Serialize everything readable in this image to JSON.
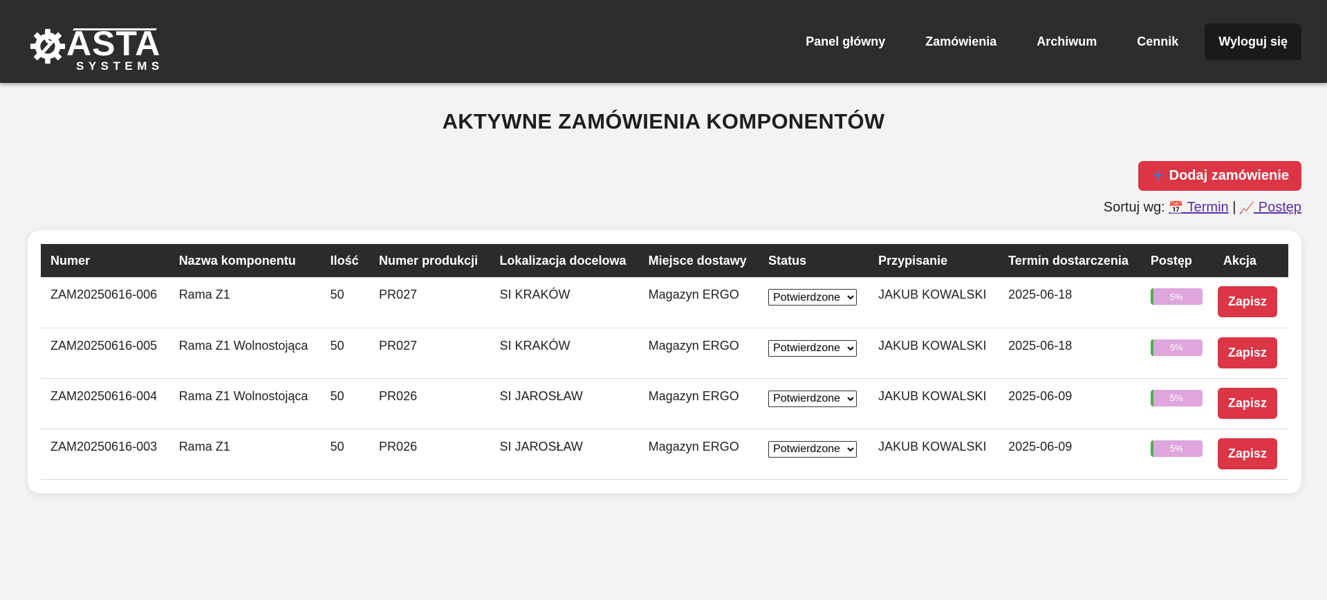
{
  "brand": {
    "logo_main": "ASTA",
    "logo_sub": "SYSTEMS"
  },
  "nav": {
    "items": [
      {
        "label": "Panel główny"
      },
      {
        "label": "Zamówienia"
      },
      {
        "label": "Archiwum"
      },
      {
        "label": "Cennik"
      }
    ],
    "logout_label": "Wyloguj się"
  },
  "page": {
    "title": "AKTYWNE ZAMÓWIENIA KOMPONENTÓW",
    "add_button_label": "Dodaj zamówienie",
    "add_button_icon": "plus-icon",
    "sort_label": "Sortuj wg:",
    "sort_separator": "|",
    "sort_options": [
      {
        "label": " Termin",
        "icon": "calendar-icon"
      },
      {
        "label": " Postęp",
        "icon": "chart-increasing-icon"
      }
    ]
  },
  "table": {
    "headers": [
      "Numer",
      "Nazwa komponentu",
      "Ilość",
      "Numer produkcji",
      "Lokalizacja docelowa",
      "Miejsce dostawy",
      "Status",
      "Przypisanie",
      "Termin dostarczenia",
      "Postęp",
      "Akcja"
    ],
    "status_options": [
      "Potwierdzone"
    ],
    "save_label": "Zapisz",
    "rows": [
      {
        "numer": "ZAM20250616-006",
        "nazwa": "Rama Z1",
        "ilosc": "50",
        "produkcja": "PR027",
        "lokalizacja": "SI KRAKÓW",
        "miejsce": "Magazyn ERGO",
        "status": "Potwierdzone",
        "przypisanie": "JAKUB KOWALSKI",
        "termin": "2025-06-18",
        "postep": 5,
        "postep_label": "5%"
      },
      {
        "numer": "ZAM20250616-005",
        "nazwa": "Rama Z1 Wolnostojąca",
        "ilosc": "50",
        "produkcja": "PR027",
        "lokalizacja": "SI KRAKÓW",
        "miejsce": "Magazyn ERGO",
        "status": "Potwierdzone",
        "przypisanie": "JAKUB KOWALSKI",
        "termin": "2025-06-18",
        "postep": 5,
        "postep_label": "5%"
      },
      {
        "numer": "ZAM20250616-004",
        "nazwa": "Rama Z1 Wolnostojąca",
        "ilosc": "50",
        "produkcja": "PR026",
        "lokalizacja": "SI JAROSŁAW",
        "miejsce": "Magazyn ERGO",
        "status": "Potwierdzone",
        "przypisanie": "JAKUB KOWALSKI",
        "termin": "2025-06-09",
        "postep": 5,
        "postep_label": "5%"
      },
      {
        "numer": "ZAM20250616-003",
        "nazwa": "Rama Z1",
        "ilosc": "50",
        "produkcja": "PR026",
        "lokalizacja": "SI JAROSŁAW",
        "miejsce": "Magazyn ERGO",
        "status": "Potwierdzone",
        "przypisanie": "JAKUB KOWALSKI",
        "termin": "2025-06-09",
        "postep": 5,
        "postep_label": "5%"
      }
    ]
  },
  "colors": {
    "header_bg": "#2d2d2d",
    "accent_red": "#dc3545",
    "progress_bg": "#dfa6dd",
    "progress_fill": "#4caf50",
    "link": "#5a2ea6"
  }
}
